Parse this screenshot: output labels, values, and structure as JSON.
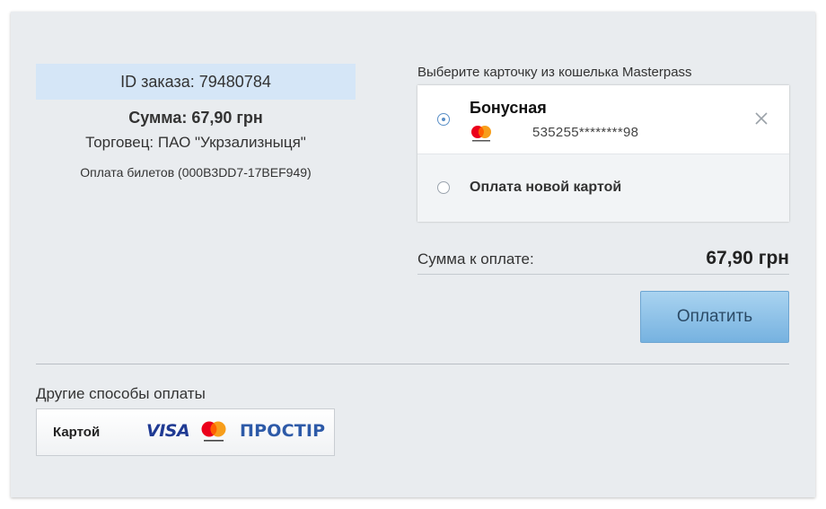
{
  "order": {
    "id_text": "ID заказа: 79480784",
    "amount_text": "Сумма: 67,90 грн",
    "merchant_text": "Торговец: ПАО \"Укрзализныця\"",
    "description": "Оплата билетов (000B3DD7-17BEF949)"
  },
  "wallet": {
    "title": "Выберите карточку из кошелька Masterpass",
    "cards": [
      {
        "name": "Бонусная",
        "number": "535255********98",
        "brand_icon": "mastercard-icon",
        "selected": true
      }
    ],
    "new_card_label": "Оплата новой картой"
  },
  "payment": {
    "total_label": "Сумма к оплате:",
    "total_value": "67,90 грн",
    "pay_button": "Оплатить"
  },
  "other_methods": {
    "title": "Другие способы оплаты",
    "card_label": "Картой",
    "visa_text": "VISA",
    "prostir_text": "ПРОСТІР"
  },
  "colors": {
    "panel_bg": "#e9ecef",
    "order_id_bg": "#d5e6f7",
    "pay_button": "#8ec3e8",
    "radio_accent": "#5a8fc7",
    "mastercard_red": "#eb001b",
    "mastercard_orange": "#f79e1b"
  }
}
